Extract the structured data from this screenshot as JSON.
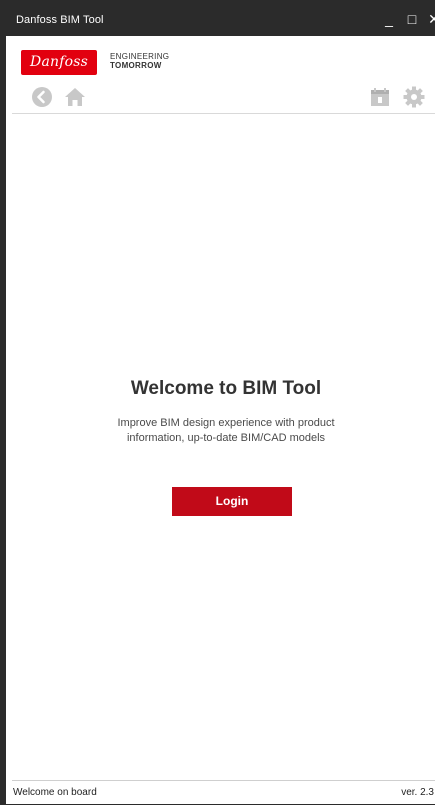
{
  "window": {
    "title": "Danfoss BIM Tool",
    "controls": {
      "minimize": "_",
      "maximize": "□",
      "close": "✕"
    }
  },
  "brand": {
    "logo_text": "Danfoss",
    "tagline_line1": "ENGINEERING",
    "tagline_line2": "TOMORROW",
    "logo_color": "#e2000f"
  },
  "toolbar": {
    "icons": [
      "back-icon",
      "home-icon",
      "calendar-icon",
      "settings-icon"
    ]
  },
  "main": {
    "title": "Welcome to BIM Tool",
    "description": "Improve BIM design experience with product information, up-to-date BIM/CAD models",
    "login_label": "Login",
    "login_color": "#c10a18"
  },
  "statusbar": {
    "left": "Welcome on board",
    "right": "ver. 2.3"
  }
}
